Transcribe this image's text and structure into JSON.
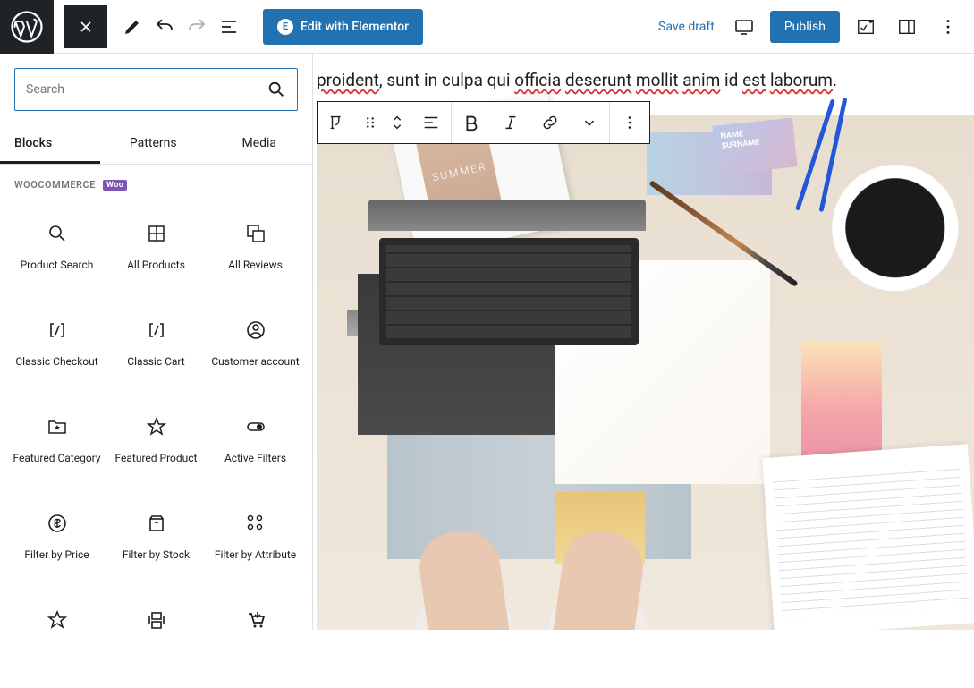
{
  "toolbar": {
    "elementor_label": "Edit with Elementor",
    "save_draft": "Save draft",
    "publish": "Publish"
  },
  "sidebar": {
    "search_placeholder": "Search",
    "tabs": [
      "Blocks",
      "Patterns",
      "Media"
    ],
    "section_title": "WOOCOMMERCE",
    "section_badge": "Woo",
    "blocks": [
      {
        "label": "Product Search"
      },
      {
        "label": "All Products"
      },
      {
        "label": "All Reviews"
      },
      {
        "label": "Classic Checkout"
      },
      {
        "label": "Classic Cart"
      },
      {
        "label": "Customer account"
      },
      {
        "label": "Featured Category"
      },
      {
        "label": "Featured Product"
      },
      {
        "label": "Active Filters"
      },
      {
        "label": "Filter by Price"
      },
      {
        "label": "Filter by Stock"
      },
      {
        "label": "Filter by Attribute"
      },
      {
        "label": ""
      },
      {
        "label": ""
      },
      {
        "label": ""
      }
    ]
  },
  "content": {
    "paragraph_plain": "proident, sunt in culpa qui officia deserunt mollit anim id est laborum.",
    "underlined_words": [
      "proident",
      "officia",
      "deserunt",
      "mollit",
      "anim",
      "est",
      "laborum"
    ]
  }
}
